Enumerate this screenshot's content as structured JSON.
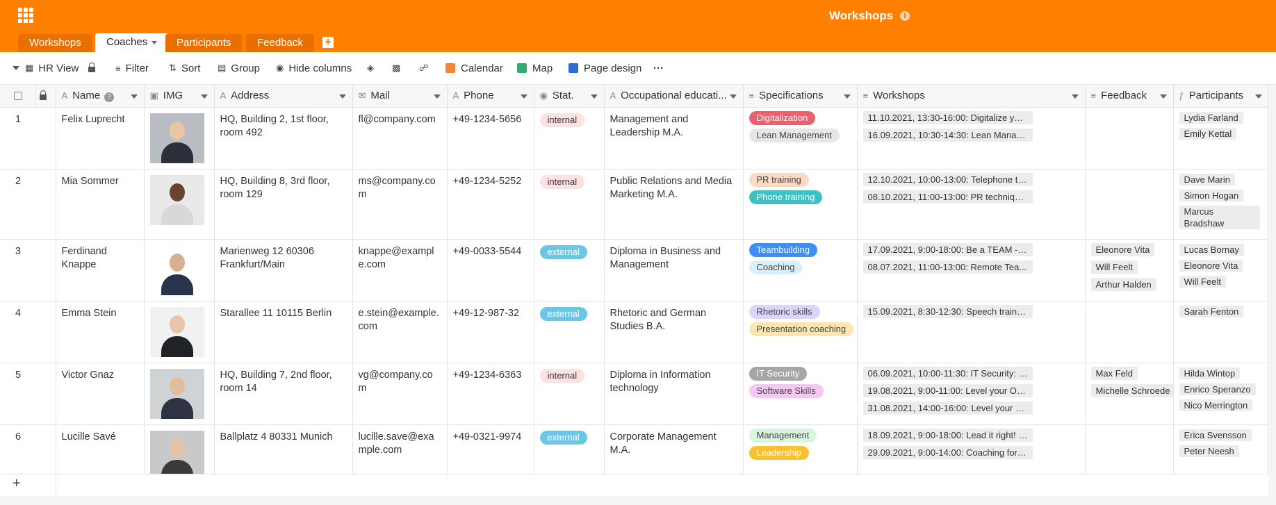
{
  "app": {
    "title": "Workshops"
  },
  "tabs": [
    {
      "label": "Workshops"
    },
    {
      "label": "Coaches"
    },
    {
      "label": "Participants"
    },
    {
      "label": "Feedback"
    }
  ],
  "toolbar": {
    "view": "HR View",
    "filter": "Filter",
    "sort": "Sort",
    "group": "Group",
    "hide_columns": "Hide columns",
    "calendar": "Calendar",
    "map": "Map",
    "page_design": "Page design",
    "more": "···"
  },
  "columns": {
    "name": "Name",
    "img": "IMG",
    "address": "Address",
    "mail": "Mail",
    "phone": "Phone",
    "status": "Stat.",
    "education": "Occupational educati...",
    "specifications": "Specifications",
    "workshops": "Workshops",
    "feedback": "Feedback",
    "participants": "Participants"
  },
  "rows": [
    {
      "index": "1",
      "name": "Felix Luprecht",
      "address": "HQ, Building 2, 1st floor, room 492",
      "mail": "fl@company.com",
      "phone": "+49-1234-5656",
      "status": "internal",
      "education": "Management and Leadership M.A.",
      "specs": [
        "Digitalization",
        "Lean Management"
      ],
      "workshops": [
        "11.10.2021, 13:30-16:00: Digitalize you...",
        "16.09.2021, 10:30-14:30: Lean Manage..."
      ],
      "feedback": [],
      "participants": [
        "Lydia Farland",
        "Emily Kettal"
      ]
    },
    {
      "index": "2",
      "name": "Mia Sommer",
      "address": "HQ, Building 8, 3rd floor, room 129",
      "mail": "ms@company.com",
      "phone": "+49-1234-5252",
      "status": "internal",
      "education": "Public Relations and Media Marketing M.A.",
      "specs": [
        "PR training",
        "Phone training"
      ],
      "workshops": [
        "12.10.2021, 10:00-13:00: Telephone tr...",
        "08.10.2021, 11:00-13:00: PR technique..."
      ],
      "feedback": [],
      "participants": [
        "Dave Marin",
        "Simon Hogan",
        "Marcus Bradshaw"
      ]
    },
    {
      "index": "3",
      "name": "Ferdinand Knappe",
      "address": "Marienweg 12 60306 Frankfurt/Main",
      "mail": "knappe@example.com",
      "phone": "+49-0033-5544",
      "status": "external",
      "education": "Diploma in Business and Management",
      "specs": [
        "Teambuilding",
        "Coaching"
      ],
      "workshops": [
        "17.09.2021, 9:00-18:00: Be a TEAM - m...",
        "08.07.2021, 11:00-13:00: Remote Tea..."
      ],
      "feedback": [
        "Eleonore Vita",
        "Will Feelt",
        "Arthur Halden"
      ],
      "participants": [
        "Lucas Bornay",
        "Eleonore Vita",
        "Will Feelt"
      ]
    },
    {
      "index": "4",
      "name": "Emma Stein",
      "address": "Starallee 11 10115 Berlin",
      "mail": "e.stein@example.com",
      "phone": "+49-12-987-32",
      "status": "external",
      "education": "Rhetoric and German Studies B.A.",
      "specs": [
        "Rhetoric skills",
        "Presentation coaching"
      ],
      "workshops": [
        "15.09.2021, 8:30-12:30: Speech trainin..."
      ],
      "feedback": [],
      "participants": [
        "Sarah Fenton"
      ]
    },
    {
      "index": "5",
      "name": "Victor Gnaz",
      "address": "HQ, Building 7, 2nd floor, room 14",
      "mail": "vg@company.com",
      "phone": "+49-1234-6363",
      "status": "internal",
      "education": "Diploma in Information technology",
      "specs": [
        "IT Security",
        "Software Skills"
      ],
      "workshops": [
        "06.09.2021, 10:00-11:30: IT Security: T...",
        "19.08.2021, 9:00-11:00: Level your Offi...",
        "31.08.2021, 14:00-16:00: Level your Of..."
      ],
      "feedback": [
        "Max Feld",
        "Michelle Schroede"
      ],
      "participants": [
        "Hilda Wintop",
        "Enrico Speranzo",
        "Nico Merrington"
      ]
    },
    {
      "index": "6",
      "name": "Lucille Savé",
      "address": "Ballplatz 4 80331 Munich",
      "mail": "lucille.save@example.com",
      "phone": "+49-0321-9974",
      "status": "external",
      "education": "Corporate Management M.A.",
      "specs": [
        "Management",
        "Leadership"
      ],
      "workshops": [
        "18.09.2021, 9:00-18:00: Lead it right! L...",
        "29.09.2021, 9:00-14:00: Coaching for p..."
      ],
      "feedback": [],
      "participants": [
        "Erica Svensson",
        "Peter Neesh"
      ]
    }
  ],
  "colors": {
    "header": "#ff8000",
    "tag_colors": {
      "Digitalization": [
        "#e8616e",
        "#fff"
      ],
      "Lean Management": [
        "#e6e6e6",
        "#444"
      ],
      "PR training": [
        "#fcd9c2",
        "#444"
      ],
      "Phone training": [
        "#3dc2c4",
        "#fff"
      ],
      "Teambuilding": [
        "#3f8ff0",
        "#fff"
      ],
      "Coaching": [
        "#d7f0fa",
        "#444"
      ],
      "Rhetoric skills": [
        "#dcd4fa",
        "#444"
      ],
      "Presentation coaching": [
        "#fbe6b0",
        "#444"
      ],
      "IT Security": [
        "#a6a6a6",
        "#fff"
      ],
      "Software Skills": [
        "#f7c7f3",
        "#444"
      ],
      "Management": [
        "#d8f5dd",
        "#444"
      ],
      "Leadership": [
        "#f7c12f",
        "#fff"
      ]
    }
  }
}
